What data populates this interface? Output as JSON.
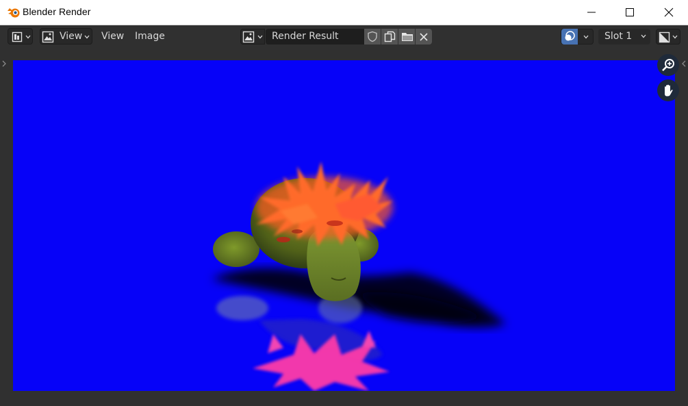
{
  "window": {
    "title": "Blender Render",
    "icons": [
      "blender-logo",
      "minimize-icon",
      "maximize-icon",
      "close-icon"
    ]
  },
  "header": {
    "editor_type_icon": "image-editor-icon",
    "view_mode": {
      "label": "View",
      "icon": "image-icon"
    },
    "menus": [
      "View",
      "Image"
    ],
    "image": {
      "browse_icon": "image-browse-icon",
      "name": "Render Result",
      "actions": [
        "fake-user-shield-icon",
        "duplicate-icon",
        "open-folder-icon",
        "unlink-icon"
      ]
    },
    "overlay_icon": "overlay-toggle-icon",
    "slot": "Slot 1",
    "display_channels_icon": "display-channels-icon"
  },
  "viewport": {
    "content": "render-result-image",
    "gizmos": [
      "zoom-icon",
      "pan-hand-icon"
    ]
  },
  "colors": {
    "title_bar": "#ffffff",
    "header_bg": "#303030",
    "render_background": "#0602f8",
    "overlay_active": "#4772b3"
  }
}
